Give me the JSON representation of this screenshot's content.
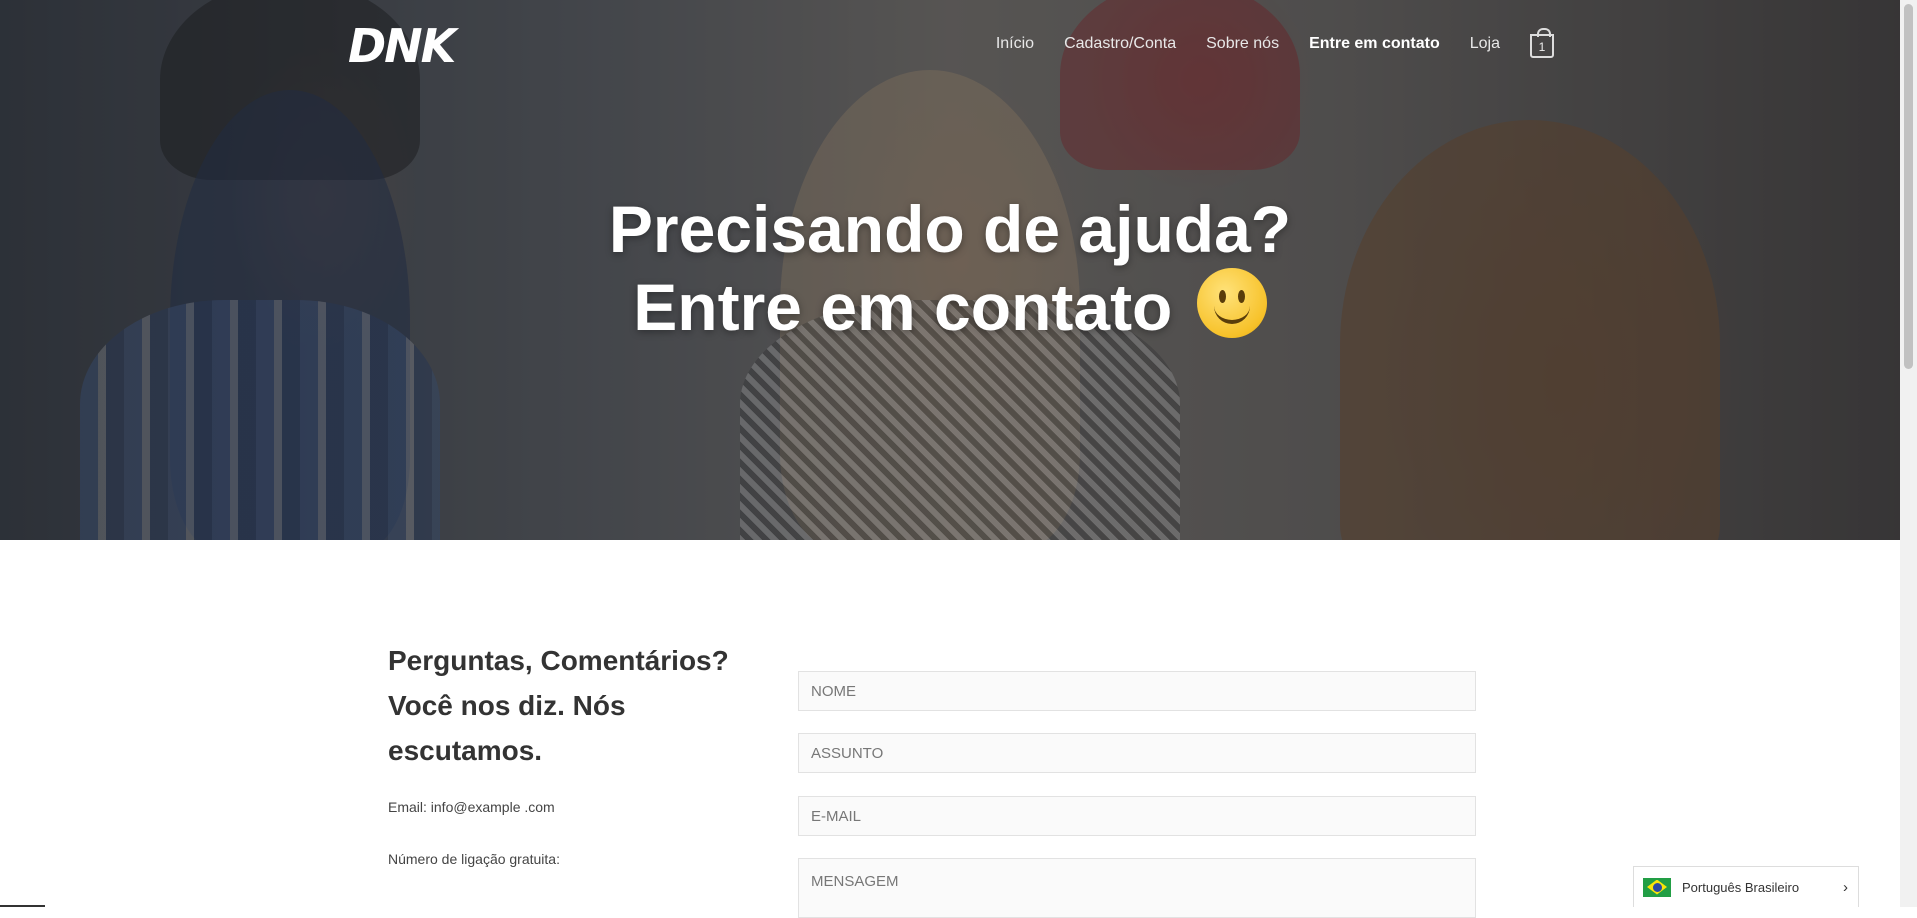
{
  "header": {
    "logo": "DNK",
    "nav": [
      {
        "label": "Início"
      },
      {
        "label": "Cadastro/Conta"
      },
      {
        "label": "Sobre nós"
      },
      {
        "label": "Entre em contato",
        "active": true
      },
      {
        "label": "Loja"
      }
    ],
    "cart_count": "1"
  },
  "hero": {
    "line1": "Precisando de ajuda?",
    "line2": "Entre em contato"
  },
  "contact": {
    "heading": "Perguntas, Comentários? Você nos diz. Nós escutamos.",
    "email": "Email: info@example .com",
    "phone": "Número de ligação gratuita:"
  },
  "form": {
    "name_placeholder": "NOME",
    "subject_placeholder": "ASSUNTO",
    "email_placeholder": "E-MAIL",
    "message_placeholder": "MENSAGEM"
  },
  "language": {
    "label": "Português Brasileiro"
  }
}
